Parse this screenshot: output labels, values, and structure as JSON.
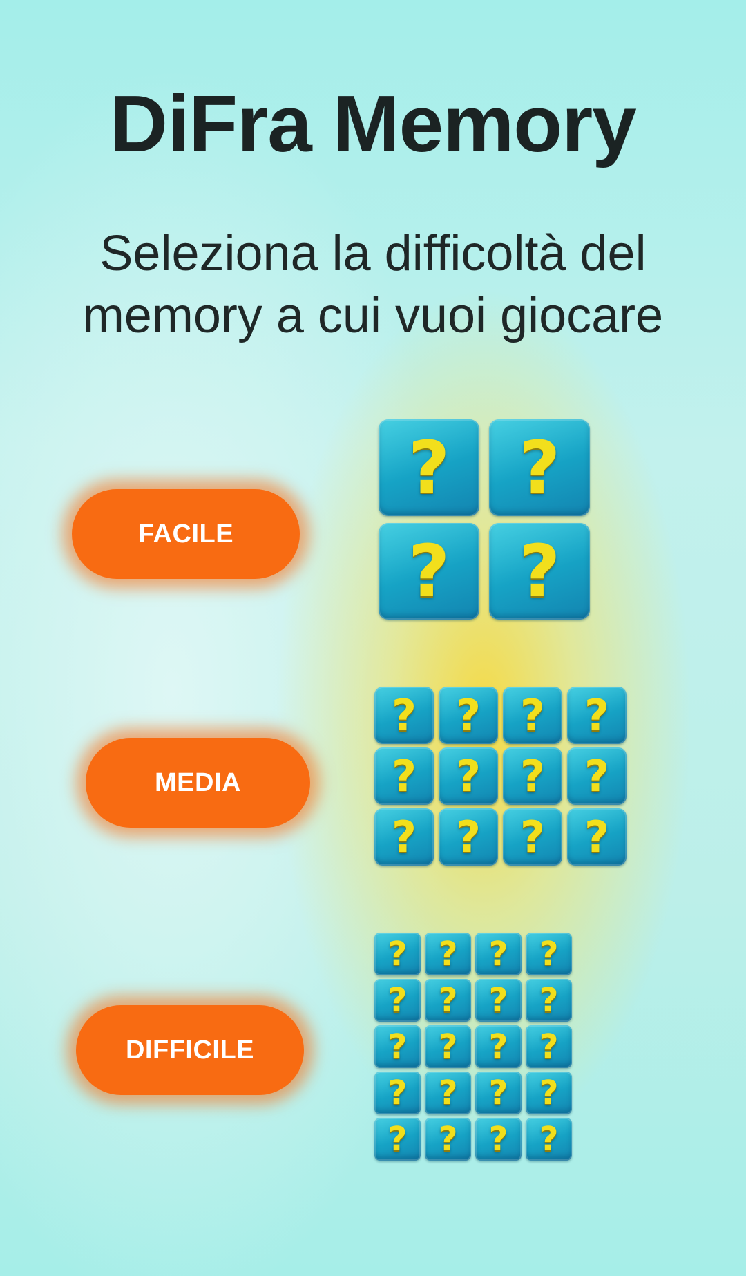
{
  "header": {
    "title": "DiFra Memory",
    "subtitle_line1": "Seleziona la difficoltà del",
    "subtitle_line2": "memory a cui vuoi giocare"
  },
  "levels": [
    {
      "label": "FACILE",
      "rows": 2,
      "cols": 2
    },
    {
      "label": "MEDIA",
      "rows": 3,
      "cols": 4
    },
    {
      "label": "DIFFICILE",
      "rows": 5,
      "cols": 4
    }
  ],
  "card": {
    "glyph": "?",
    "icon": "question-mark-icon"
  },
  "colors": {
    "button": "#f86b12",
    "card": "#17a7c8",
    "glyph": "#f2df1c",
    "background": "#b8efea",
    "glow": "#ffd628"
  }
}
